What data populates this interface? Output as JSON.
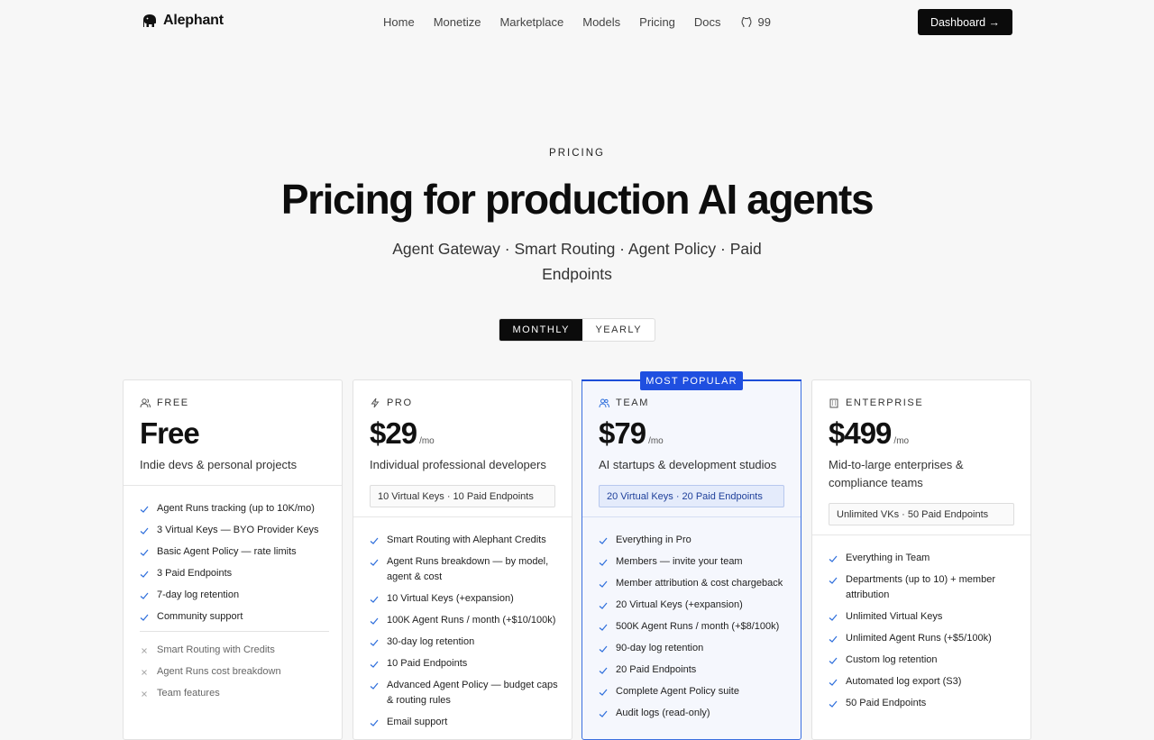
{
  "nav": {
    "brand": "Alephant",
    "links": [
      "Home",
      "Monetize",
      "Marketplace",
      "Models",
      "Pricing",
      "Docs"
    ],
    "github_count": "99",
    "dashboard_label": "Dashboard →"
  },
  "hero": {
    "eyebrow": "PRICING",
    "title": "Pricing for production AI agents",
    "subtitle": "Agent Gateway · Smart Routing · Agent Policy · Paid Endpoints"
  },
  "billing_toggle": {
    "monthly": "MONTHLY",
    "yearly": "YEARLY",
    "selected": "MONTHLY"
  },
  "badge": "MOST POPULAR",
  "plans": {
    "free": {
      "tier": "FREE",
      "price": "Free",
      "desc": "Indie devs & personal projects",
      "features": [
        "Agent Runs tracking (up to 10K/mo)",
        "3 Virtual Keys — BYO Provider Keys",
        "Basic Agent Policy — rate limits",
        "3 Paid Endpoints",
        "7-day log retention",
        "Community support"
      ],
      "excluded": [
        "Smart Routing with Credits",
        "Agent Runs cost breakdown",
        "Team features"
      ]
    },
    "pro": {
      "tier": "PRO",
      "price": "$29",
      "per": "/mo",
      "desc": "Individual professional developers",
      "keys": "10 Virtual Keys · 10 Paid Endpoints",
      "features": [
        "Smart Routing with Alephant Credits",
        "Agent Runs breakdown — by model, agent & cost",
        "10 Virtual Keys (+expansion)",
        "100K Agent Runs / month (+$10/100k)",
        "30-day log retention",
        "10 Paid Endpoints",
        "Advanced Agent Policy — budget caps & routing rules",
        "Email support"
      ]
    },
    "team": {
      "tier": "TEAM",
      "price": "$79",
      "per": "/mo",
      "desc": "AI startups & development studios",
      "keys": "20 Virtual Keys · 20 Paid Endpoints",
      "features": [
        "Everything in Pro",
        "Members — invite your team",
        "Member attribution & cost chargeback",
        "20 Virtual Keys (+expansion)",
        "500K Agent Runs / month (+$8/100k)",
        "90-day log retention",
        "20 Paid Endpoints",
        "Complete Agent Policy suite",
        "Audit logs (read-only)"
      ]
    },
    "enterprise": {
      "tier": "ENTERPRISE",
      "price": "$499",
      "per": "/mo",
      "desc": "Mid-to-large enterprises & compliance teams",
      "keys": "Unlimited VKs · 50 Paid Endpoints",
      "features": [
        "Everything in Team",
        "Departments (up to 10) + member attribution",
        "Unlimited Virtual Keys",
        "Unlimited Agent Runs (+$5/100k)",
        "Custom log retention",
        "Automated log export (S3)",
        "50 Paid Endpoints"
      ]
    }
  },
  "colors": {
    "accent": "#1f4fe0",
    "check": "#2f6fdc",
    "dark": "#0b0b0b"
  }
}
